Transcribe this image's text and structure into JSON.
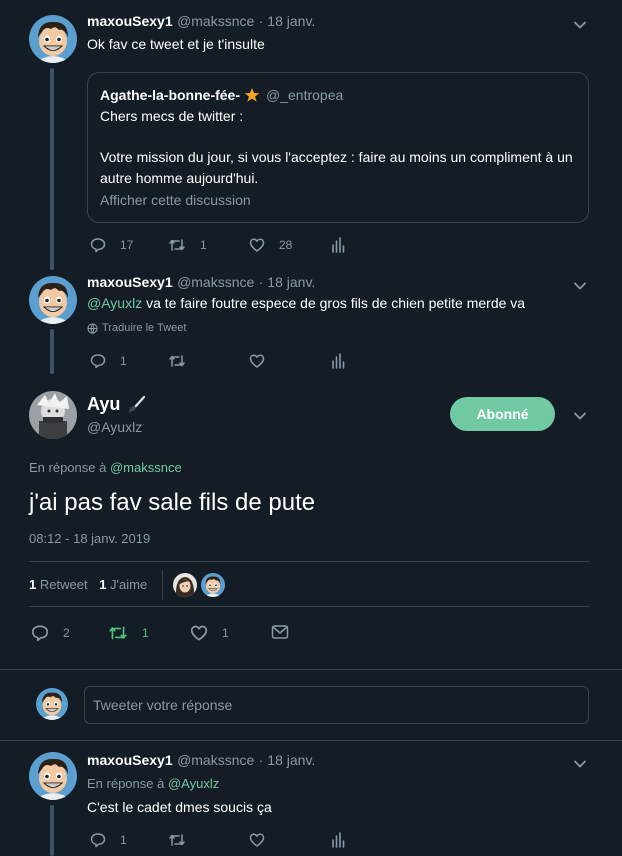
{
  "tweet1": {
    "display_name": "maxouSexy1",
    "handle": "@makssnce",
    "date": "· 18 janv.",
    "text": "Ok fav ce tweet et je t'insulte",
    "quote": {
      "display_name": "Agathe-la-bonne-fée-",
      "handle": "@_entropea",
      "line1": "Chers mecs de twitter :",
      "line2": "Votre mission du jour, si vous l'acceptez : faire au moins un compliment à un",
      "line3": "autre homme aujourd'hui.",
      "show_thread": "Afficher cette discussion"
    },
    "replies": "17",
    "retweets": "1",
    "likes": "28"
  },
  "tweet2": {
    "display_name": "maxouSexy1",
    "handle": "@makssnce",
    "date": "· 18 janv.",
    "mention": "@Ayuxlz",
    "text": " va te faire foutre espece de gros fils de chien petite merde va",
    "translate": "Traduire le Tweet",
    "replies": "1"
  },
  "main": {
    "display_name": "Ayu",
    "handle": "@Ayuxlz",
    "follow_label": "Abonné",
    "reply_to_prefix": "En réponse à ",
    "reply_to_handle": "@makssnce",
    "text": "j'ai pas fav sale fils de pute",
    "timestamp": "08:12 - 18 janv. 2019",
    "retweet_count": "1",
    "retweet_label": "Retweet",
    "like_count": "1",
    "like_label": "J'aime",
    "replies": "2",
    "retweets": "1",
    "likes": "1"
  },
  "compose": {
    "placeholder": "Tweeter votre réponse"
  },
  "tweet3": {
    "display_name": "maxouSexy1",
    "handle": "@makssnce",
    "date": "· 18 janv.",
    "reply_to_prefix": "En réponse à ",
    "reply_to_handle": "@Ayuxlz",
    "text": "C'est le cadet dmes soucis ça",
    "replies": "1"
  },
  "colors": {
    "background": "#141d26",
    "accent": "#71c9a3",
    "secondary_text": "#8899a6",
    "border": "#38444d"
  }
}
